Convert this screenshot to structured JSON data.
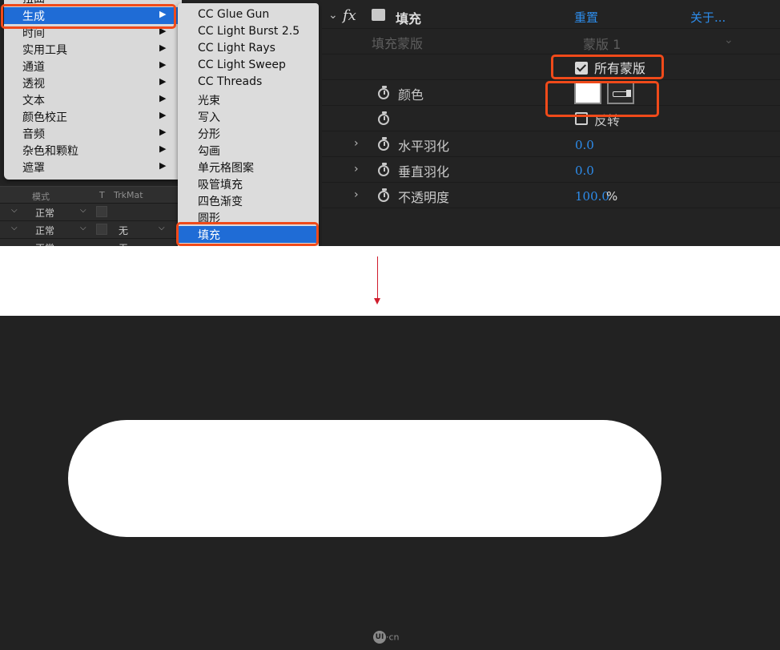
{
  "menu": {
    "items": [
      {
        "label": "扭曲",
        "arrow": "▶"
      },
      {
        "label": "生成",
        "arrow": "▶"
      },
      {
        "label": "时间",
        "arrow": "▶"
      },
      {
        "label": "实用工具",
        "arrow": "▶"
      },
      {
        "label": "通道",
        "arrow": "▶"
      },
      {
        "label": "透视",
        "arrow": "▶"
      },
      {
        "label": "文本",
        "arrow": "▶"
      },
      {
        "label": "颜色校正",
        "arrow": "▶"
      },
      {
        "label": "音频",
        "arrow": "▶"
      },
      {
        "label": "杂色和颗粒",
        "arrow": "▶"
      },
      {
        "label": "遮罩",
        "arrow": "▶"
      }
    ]
  },
  "submenu": {
    "items": [
      "CC Glue Gun",
      "CC Light Burst 2.5",
      "CC Light Rays",
      "CC Light Sweep",
      "CC Threads",
      "光束",
      "写入",
      "分形",
      "勾画",
      "单元格图案",
      "吸管填充",
      "四色渐变",
      "圆形",
      "填充"
    ]
  },
  "timeline": {
    "header": {
      "mode": "模式",
      "t": "T",
      "trkmat": "TrkMat"
    },
    "rows": [
      {
        "mode": "正常",
        "trkmat": ""
      },
      {
        "mode": "正常",
        "trkmat": "无"
      },
      {
        "mode": "正常",
        "trkmat": "无"
      }
    ]
  },
  "effects": {
    "fx_symbol": "fx",
    "effect_name": "填充",
    "reset": "重置",
    "about": "关于...",
    "fill_mask_label": "填充蒙版",
    "fill_mask_value": "蒙版 1",
    "all_masks_label": "所有蒙版",
    "color_label": "颜色",
    "invert_label": "反转",
    "h_feather_label": "水平羽化",
    "h_feather_value": "0.0",
    "v_feather_label": "垂直羽化",
    "v_feather_value": "0.0",
    "opacity_label": "不透明度",
    "opacity_value": "100.0",
    "opacity_unit": "%"
  },
  "watermark": {
    "logo": "UI",
    "suffix": "·cn"
  },
  "colors": {
    "highlight": "#f04a1a",
    "menu_selection": "#1f6cd6",
    "link_blue": "#2d8ceb",
    "arrow": "#d01c2c",
    "fill_color": "#ffffff"
  }
}
